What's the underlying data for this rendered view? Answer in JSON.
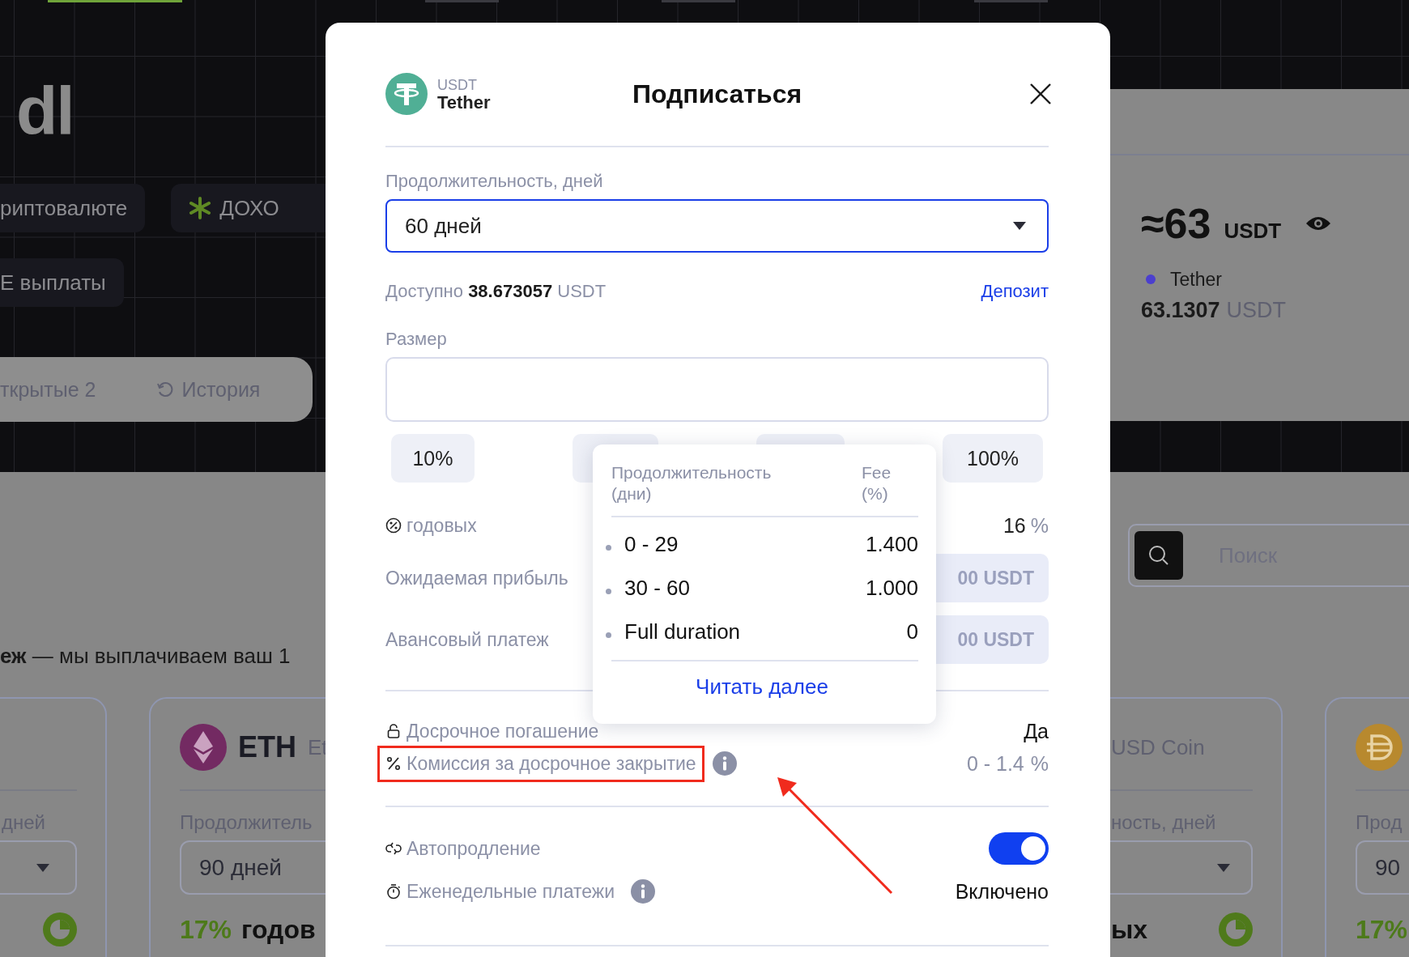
{
  "top_markers": [
    {
      "selected": true
    },
    {
      "selected": false
    },
    {
      "selected": false
    },
    {
      "selected": false
    }
  ],
  "heading": "dl",
  "chip_rows": [
    [
      {
        "label": "риптовалюте",
        "kind": "plain"
      },
      {
        "label": "ДОХО",
        "kind": "star"
      }
    ],
    [
      {
        "label": "E выплаты",
        "kind": "plain"
      }
    ]
  ],
  "tabs": [
    {
      "label": "ткрытые 2",
      "kind": "plain"
    },
    {
      "label": "История",
      "kind": "history"
    }
  ],
  "balance": {
    "amount": "≈63",
    "unit": "USDT",
    "asset": "Tether",
    "holding": "63.1307",
    "holding_unit": "USDT"
  },
  "search": {
    "placeholder": "Поиск"
  },
  "note": "**еж** — мы выплачиваем ваш 1",
  "cards": [
    {
      "duration_label": "дней",
      "pie": true
    },
    {
      "symbol": "ETH",
      "name": "Et",
      "duration_label": "Продолжитель",
      "duration": "90 дней",
      "apy": "17%",
      "apy_label": "годов"
    },
    {
      "name": "USD Coin",
      "duration_label": "ность, дней",
      "apy_label": "ых",
      "pie": true
    },
    {
      "duration_label": "Прод",
      "duration": "90",
      "apy": "17%"
    }
  ],
  "modal": {
    "asset_code": "USDT",
    "asset_name": "Tether",
    "title": "Подписаться",
    "duration": {
      "label": "Продолжительность, дней",
      "value": "60 дней",
      "focused": true
    },
    "available": "Доступно **38.673057** USDT",
    "deposit_link": "Депозит",
    "size_label": "Размер",
    "percent_buttons": [
      {
        "label": "10%",
        "kind": "label"
      },
      {
        "kind": "covered"
      },
      {
        "kind": "covered"
      },
      {
        "label": "100%",
        "kind": "label"
      }
    ],
    "stats": [
      {
        "label": "годовых",
        "value": "16",
        "unit": "%",
        "kind": "plain"
      },
      {
        "label": "Ожидаемая прибыль",
        "value": "00 USDT",
        "kind": "boxed"
      },
      {
        "label": "Авансовый платеж",
        "value": "00 USDT",
        "kind": "boxed"
      }
    ],
    "terms": [
      {
        "label": "Досрочное погашение",
        "value": "Да",
        "highlighted": false
      },
      {
        "label": "Комиссия за досрочное закрытие",
        "info": true,
        "value": "0 - 1.4",
        "unit": "%",
        "highlighted": true
      }
    ],
    "options": [
      {
        "label": "Автопродление",
        "kind": "toggle",
        "on": true
      },
      {
        "label": "Еженедельные платежи",
        "info": true,
        "kind": "text",
        "value": "Включено"
      }
    ]
  },
  "popover": {
    "columns": [
      "Продолжительность (дни)",
      "Fee (%)"
    ],
    "rows": [
      {
        "duration": "0 - 29",
        "fee": "1.400"
      },
      {
        "duration": "30 - 60",
        "fee": "1.000"
      },
      {
        "duration": "Full duration",
        "fee": "0"
      }
    ],
    "link": "Читать далее"
  }
}
